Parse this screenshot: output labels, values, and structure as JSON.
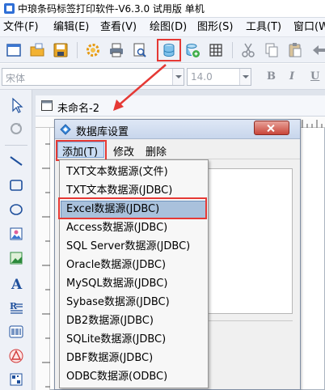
{
  "window": {
    "title": "中琅条码标签打印软件-V6.3.0 试用版 单机"
  },
  "menubar": {
    "items": [
      {
        "label": "文件(F)"
      },
      {
        "label": "编辑(E)"
      },
      {
        "label": "查看(V)"
      },
      {
        "label": "绘图(D)"
      },
      {
        "label": "图形(S)"
      },
      {
        "label": "工具(T)"
      },
      {
        "label": "窗口(W)"
      }
    ]
  },
  "toolbar": {
    "icons": [
      "new-file-icon",
      "open-folder-icon",
      "save-icon",
      "settings-gear-icon",
      "print-icon",
      "print-preview-icon",
      "database-icon",
      "database-refresh-icon",
      "grid-icon",
      "cut-icon",
      "copy-icon",
      "undo-icon"
    ]
  },
  "fontbar": {
    "font_name": "宋体",
    "font_size": "14.0",
    "bold": "B",
    "italic": "I",
    "underline": "U"
  },
  "document": {
    "title": "未命名-2"
  },
  "dialog": {
    "title": "数据库设置",
    "menu": {
      "add": "添加(T)",
      "edit": "修改",
      "delete": "删除"
    }
  },
  "dropdown": {
    "items": [
      {
        "label": "TXT文本数据源(文件)"
      },
      {
        "label": "TXT文本数据源(JDBC)"
      },
      {
        "label": "Excel数据源(JDBC)",
        "selected": true
      },
      {
        "label": "Access数据源(JDBC)"
      },
      {
        "label": "SQL Server数据源(JDBC)"
      },
      {
        "label": "Oracle数据源(JDBC)"
      },
      {
        "label": "MySQL数据源(JDBC)"
      },
      {
        "label": "Sybase数据源(JDBC)"
      },
      {
        "label": "DB2数据源(JDBC)"
      },
      {
        "label": "SQLite数据源(JDBC)"
      },
      {
        "label": "DBF数据源(JDBC)"
      },
      {
        "label": "ODBC数据源(ODBC)"
      }
    ]
  },
  "colors": {
    "annotation_red": "#e53935",
    "selection_blue": "#a9c1dc"
  }
}
